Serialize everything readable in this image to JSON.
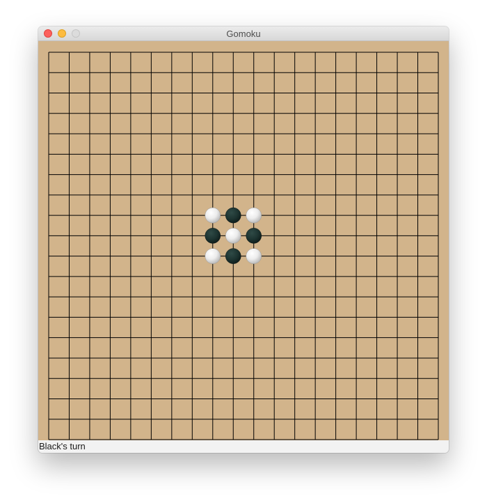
{
  "window": {
    "title": "Gomoku"
  },
  "status": {
    "text": "Black's turn"
  },
  "board": {
    "grid_size": 19,
    "wood_color": "#d2b48b",
    "line_color": "#000000",
    "stones": [
      {
        "row": 8,
        "col": 8,
        "color": "white"
      },
      {
        "row": 8,
        "col": 9,
        "color": "black"
      },
      {
        "row": 8,
        "col": 10,
        "color": "white"
      },
      {
        "row": 9,
        "col": 8,
        "color": "black"
      },
      {
        "row": 9,
        "col": 9,
        "color": "white"
      },
      {
        "row": 9,
        "col": 10,
        "color": "black"
      },
      {
        "row": 10,
        "col": 8,
        "color": "white"
      },
      {
        "row": 10,
        "col": 9,
        "color": "black"
      },
      {
        "row": 10,
        "col": 10,
        "color": "white"
      }
    ]
  },
  "colors": {
    "close_button": "#fc605c",
    "minimize_button": "#fdbc40",
    "zoom_button": "#dcdcdc",
    "black_stone": "#1d3431",
    "white_stone": "#f4f4f4"
  }
}
